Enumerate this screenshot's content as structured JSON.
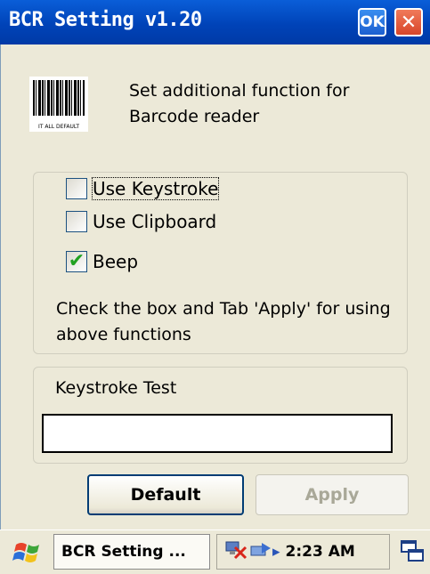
{
  "window": {
    "title": "BCR Setting v1.20",
    "ok_label": "OK",
    "close_symbol": "✕"
  },
  "header": {
    "barcode_icon": "barcode-image",
    "barcode_caption": "IT ALL DEFAULT",
    "description": "Set additional function for Barcode reader"
  },
  "options": {
    "items": [
      {
        "label": "Use Keystroke",
        "checked": false,
        "focused": true
      },
      {
        "label": "Use Clipboard",
        "checked": false,
        "focused": false
      },
      {
        "label": "Beep",
        "checked": true,
        "focused": false
      }
    ],
    "note": "Check the box and Tab 'Apply' for using above functions"
  },
  "keystroke_test": {
    "label": "Keystroke Test",
    "value": "",
    "placeholder": ""
  },
  "buttons": {
    "default_label": "Default",
    "apply_label": "Apply",
    "apply_enabled": false
  },
  "taskbar": {
    "task_label": "BCR Setting ...",
    "tray_arrow": "▸",
    "clock": "2:23 AM",
    "icons": [
      "start-flag-icon",
      "network-icon",
      "sync-icon",
      "desktop-icon"
    ]
  },
  "colors": {
    "titlebar": "#0043b8",
    "close_button": "#d8462a",
    "check": "#21a121"
  }
}
